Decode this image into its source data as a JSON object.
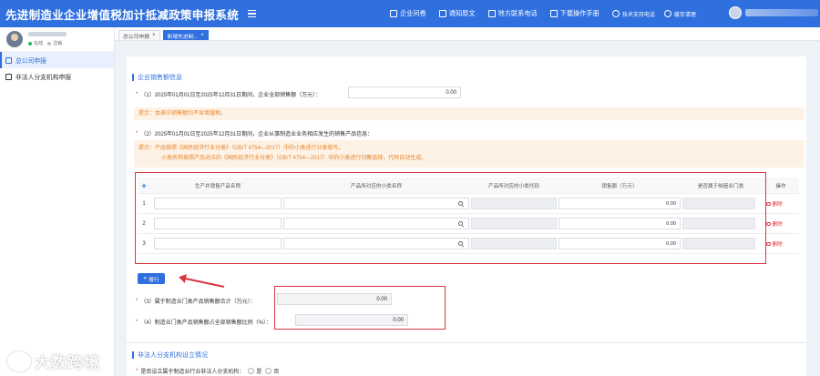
{
  "header": {
    "title": "先进制造业企业增值税加计抵减政策申报系统",
    "nav": [
      {
        "label": "企业问卷",
        "icon": "document-icon"
      },
      {
        "label": "通知原文",
        "icon": "megaphone-icon"
      },
      {
        "label": "地方联系电话",
        "icon": "phone-icon"
      },
      {
        "label": "下载操作手册",
        "icon": "download-icon"
      }
    ],
    "support": {
      "label": "技术支持电话",
      "icon": "phone-icon"
    },
    "cache": {
      "label": "缓存清理",
      "icon": "cache-clear-icon"
    }
  },
  "sidebar": {
    "status_online": "在线",
    "status_logout": "注销",
    "items": [
      {
        "label": "总公司申报",
        "active": true
      },
      {
        "label": "非法人分支机构申报",
        "active": false
      }
    ]
  },
  "tabs": [
    {
      "label": "总公司申报",
      "active": false
    },
    {
      "label": "新增先进制...",
      "active": true
    }
  ],
  "sales": {
    "section_title": "企业销售额信息",
    "q1": {
      "label": "（1）2025年01月01日至2025年12月31日期间，企业全部销售额（万元）：",
      "value": "0.00"
    },
    "tip1": "提示：本表中销售额均不含增值税。",
    "q2": {
      "label": "（2）2025年01月01日至2025年12月31日期间，企业从事制造业业务相应发生的销售产品信息："
    },
    "tip2_line1": "提示：产品按照《国民经济行业分类》（GB/T 4754—2017）中的小类进行分类填写。",
    "tip2_line2": "小类名称按照产品对应的《国民经济行业分类》（GB/T 4754—2017）中的小类进行归集选择，代码自动生成。",
    "table": {
      "headers": [
        "生产并销售产品名称",
        "产品所对应的小类名称",
        "产品所对应的小类代码",
        "销售额（万元）",
        "是否属于制造业门类",
        "操作"
      ],
      "rows": [
        {
          "index": "1",
          "amount": "0.00",
          "action": "删除"
        },
        {
          "index": "2",
          "amount": "0.00",
          "action": "删除"
        },
        {
          "index": "3",
          "amount": "0.00",
          "action": "删除"
        }
      ]
    },
    "add_row": "增行",
    "q3": {
      "label": "（3）属于制造业门类产品销售额合计（万元）：",
      "value": "0.00"
    },
    "q4": {
      "label": "（4）制造业门类产品销售额占全部销售额比例（%）：",
      "value": "0.00"
    }
  },
  "branch": {
    "section_title": "非法人分支机构设立情况",
    "question": "是否设立属于制造业行业非法人分支机构：",
    "options": [
      "是",
      "否"
    ]
  },
  "watermark": "大数跨境",
  "colors": {
    "primary": "#2f6fde",
    "danger": "#e0303a",
    "tip_bg": "#fdf2e5",
    "tip_text": "#e8852b"
  }
}
